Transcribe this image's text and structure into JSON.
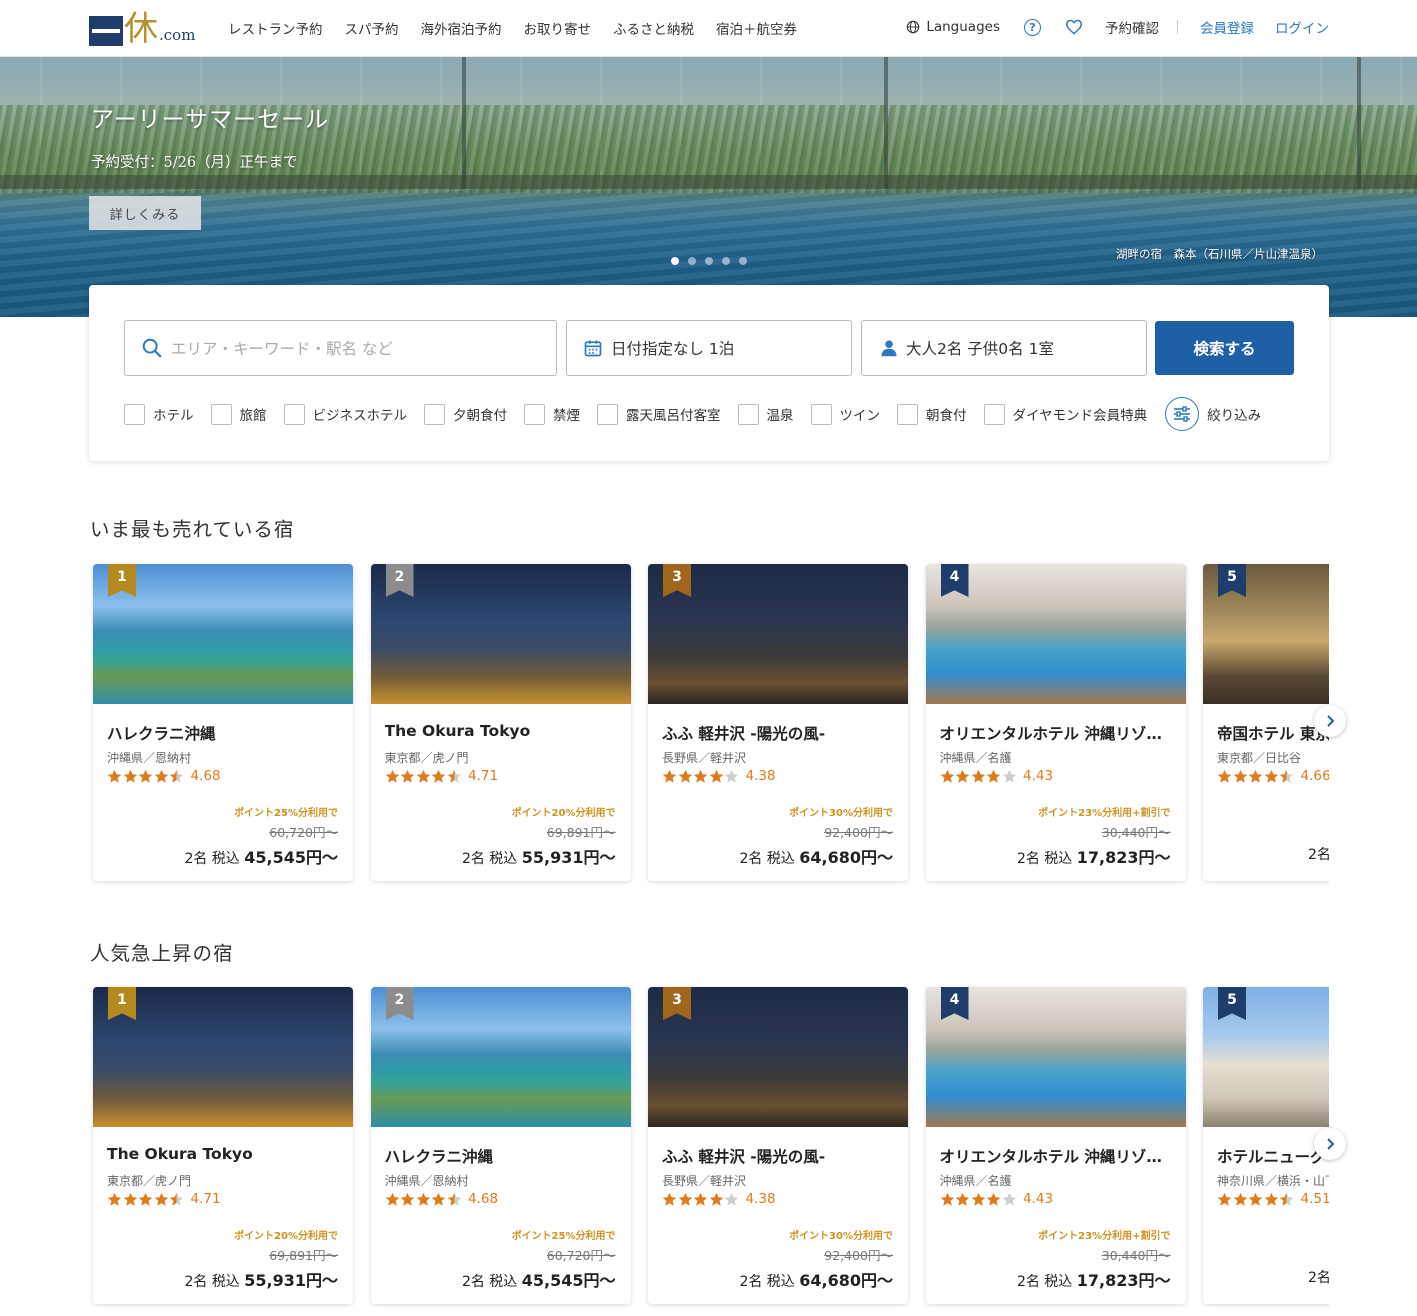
{
  "header": {
    "logo": {
      "kanji": "休",
      "suffix": ".com"
    },
    "nav": [
      "レストラン予約",
      "スパ予約",
      "海外宿泊予約",
      "お取り寄せ",
      "ふるさと納税",
      "宿泊＋航空券"
    ],
    "languages": "Languages",
    "help_icon": "?",
    "reservation_check": "予約確認",
    "signup": "会員登録",
    "login": "ログイン"
  },
  "hero": {
    "title": "アーリーサマーセール",
    "subtitle": "予約受付：5/26（月）正午まで",
    "button": "詳しくみる",
    "caption": "湖畔の宿　森本（石川県／片山津温泉）",
    "slide_count": 5,
    "active_slide": 1
  },
  "search": {
    "keyword_placeholder": "エリア・キーワード・駅名 など",
    "date": "日付指定なし 1泊",
    "people": "大人2名  子供0名  1室",
    "button": "検索する",
    "filters": [
      "ホテル",
      "旅館",
      "ビジネスホテル",
      "夕朝食付",
      "禁煙",
      "露天風呂付客室",
      "温泉",
      "ツイン",
      "朝食付",
      "ダイヤモンド会員特典"
    ],
    "refine": "絞り込み"
  },
  "colors": {
    "brand_navy": "#1f3d6b",
    "brand_gold": "#b48a1e",
    "link_blue": "#2a78c7",
    "search_button": "#1f5fa8",
    "rating_orange": "#e07b1a",
    "point_gold": "#d0921e"
  },
  "sections": [
    {
      "title": "いま最も売れている宿",
      "cards": [
        {
          "rank": "1",
          "badge": "gold",
          "image": "ocean",
          "name": "ハレクラニ沖縄",
          "location": "沖縄県／恩納村",
          "stars": 4.5,
          "rating": "4.68",
          "point": "ポイント25%分利用で",
          "original": "60,720円〜",
          "price_prefix": "2名 税込 ",
          "price": "45,545円〜"
        },
        {
          "rank": "2",
          "badge": "silver",
          "image": "city",
          "name": "The Okura Tokyo",
          "location": "東京都／虎ノ門",
          "stars": 4.5,
          "rating": "4.71",
          "point": "ポイント20%分利用で",
          "original": "69,891円〜",
          "price_prefix": "2名 税込 ",
          "price": "55,931円〜"
        },
        {
          "rank": "3",
          "badge": "bronze",
          "image": "night",
          "name": "ふふ 軽井沢 -陽光の風-",
          "location": "長野県／軽井沢",
          "stars": 4,
          "rating": "4.38",
          "point": "ポイント30%分利用で",
          "original": "92,400円〜",
          "price_prefix": "2名 税込 ",
          "price": "64,680円〜"
        },
        {
          "rank": "4",
          "badge": "navy",
          "image": "pool",
          "name": "オリエンタルホテル 沖縄リゾート&スパ",
          "location": "沖縄県／名護",
          "stars": 4,
          "rating": "4.43",
          "point": "ポイント23%分利用+割引で",
          "original": "30,440円〜",
          "price_prefix": "2名 税込 ",
          "price": "17,823円〜"
        },
        {
          "rank": "5",
          "badge": "navy",
          "image": "lobby",
          "name": "帝国ホテル 東京",
          "location": "東京都／日比谷",
          "stars": 4.5,
          "rating": "4.66",
          "point": "",
          "original": "",
          "price_prefix": "2名",
          "price": ""
        }
      ]
    },
    {
      "title": "人気急上昇の宿",
      "cards": [
        {
          "rank": "1",
          "badge": "gold",
          "image": "city",
          "name": "The Okura Tokyo",
          "location": "東京都／虎ノ門",
          "stars": 4.5,
          "rating": "4.71",
          "point": "ポイント20%分利用で",
          "original": "69,891円〜",
          "price_prefix": "2名 税込 ",
          "price": "55,931円〜"
        },
        {
          "rank": "2",
          "badge": "silver",
          "image": "ocean",
          "name": "ハレクラニ沖縄",
          "location": "沖縄県／恩納村",
          "stars": 4.5,
          "rating": "4.68",
          "point": "ポイント25%分利用で",
          "original": "60,720円〜",
          "price_prefix": "2名 税込 ",
          "price": "45,545円〜"
        },
        {
          "rank": "3",
          "badge": "bronze",
          "image": "night",
          "name": "ふふ 軽井沢 -陽光の風-",
          "location": "長野県／軽井沢",
          "stars": 4,
          "rating": "4.38",
          "point": "ポイント30%分利用で",
          "original": "92,400円〜",
          "price_prefix": "2名 税込 ",
          "price": "64,680円〜"
        },
        {
          "rank": "4",
          "badge": "navy",
          "image": "pool",
          "name": "オリエンタルホテル 沖縄リゾート&スパ",
          "location": "沖縄県／名護",
          "stars": 4,
          "rating": "4.43",
          "point": "ポイント23%分利用+割引で",
          "original": "30,440円〜",
          "price_prefix": "2名 税込 ",
          "price": "17,823円〜"
        },
        {
          "rank": "5",
          "badge": "navy",
          "image": "building",
          "name": "ホテルニューグランド",
          "location": "神奈川県／横浜・山下公園",
          "stars": 4.5,
          "rating": "4.51",
          "point": "",
          "original": "",
          "price_prefix": "2名",
          "price": ""
        }
      ]
    }
  ]
}
